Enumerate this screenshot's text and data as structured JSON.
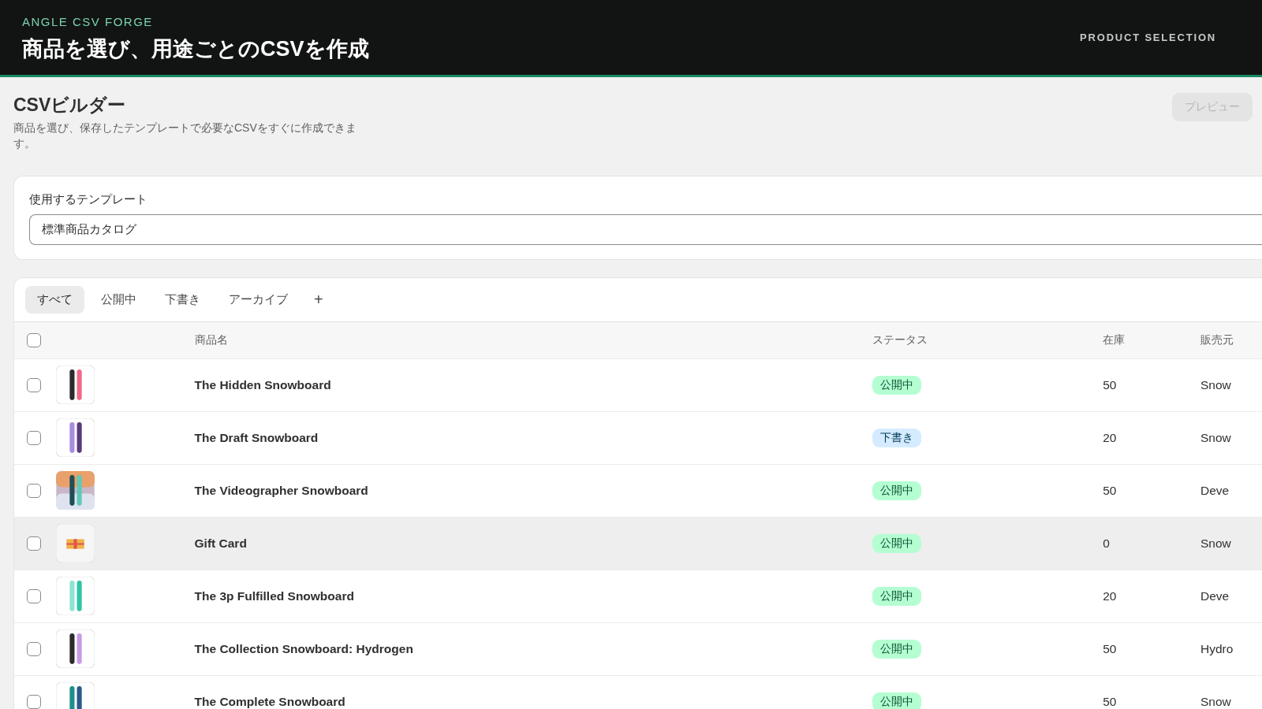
{
  "header": {
    "brand": "ANGLE CSV FORGE",
    "title": "商品を選び、用途ごとのCSVを作成",
    "section": "PRODUCT SELECTION"
  },
  "page": {
    "title": "CSVビルダー",
    "description": "商品を選び、保存したテンプレートで必要なCSVをすぐに作成できます。",
    "preview_button": {
      "label": "プレビュー",
      "disabled": true
    }
  },
  "template": {
    "label": "使用するテンプレート",
    "value": "標準商品カタログ"
  },
  "tabs": [
    {
      "label": "すべて",
      "selected": true
    },
    {
      "label": "公開中",
      "selected": false
    },
    {
      "label": "下書き",
      "selected": false
    },
    {
      "label": "アーカイブ",
      "selected": false
    }
  ],
  "add_tab": "+",
  "table": {
    "select_all": {
      "checked": false
    },
    "columns": [
      "商品名",
      "ステータス",
      "在庫",
      "販売元"
    ],
    "rows": [
      {
        "checked": false,
        "hovered": false,
        "name": "The Hidden Snowboard",
        "status": {
          "kind": "active",
          "label": "公開中"
        },
        "stock": "50",
        "vendor": "Snow"
      },
      {
        "checked": false,
        "hovered": false,
        "name": "The Draft Snowboard",
        "status": {
          "kind": "draft",
          "label": "下書き"
        },
        "stock": "20",
        "vendor": "Snow"
      },
      {
        "checked": false,
        "hovered": false,
        "name": "The Videographer Snowboard",
        "status": {
          "kind": "active",
          "label": "公開中"
        },
        "stock": "50",
        "vendor": "Deve"
      },
      {
        "checked": false,
        "hovered": true,
        "name": "Gift Card",
        "status": {
          "kind": "active",
          "label": "公開中"
        },
        "stock": "0",
        "vendor": "Snow"
      },
      {
        "checked": false,
        "hovered": false,
        "name": "The 3p Fulfilled Snowboard",
        "status": {
          "kind": "active",
          "label": "公開中"
        },
        "stock": "20",
        "vendor": "Deve"
      },
      {
        "checked": false,
        "hovered": false,
        "name": "The Collection Snowboard: Hydrogen",
        "status": {
          "kind": "active",
          "label": "公開中"
        },
        "stock": "50",
        "vendor": "Hydro"
      },
      {
        "checked": false,
        "hovered": false,
        "name": "The Complete Snowboard",
        "status": {
          "kind": "active",
          "label": "公開中"
        },
        "stock": "50",
        "vendor": "Snow"
      }
    ]
  }
}
